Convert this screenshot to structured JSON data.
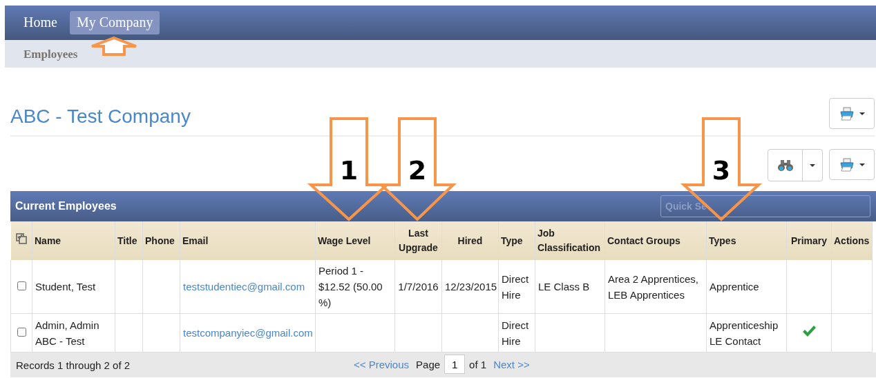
{
  "nav": {
    "items": [
      {
        "label": "Home",
        "selected": false
      },
      {
        "label": "My Company",
        "selected": true
      }
    ]
  },
  "subnav": {
    "items": [
      {
        "label": "Employees"
      }
    ]
  },
  "page_title": "ABC - Test Company",
  "panel": {
    "title": "Current Employees",
    "search": {
      "placeholder": "Quick Se"
    },
    "columns": [
      "Name",
      "Title",
      "Phone",
      "Email",
      "Wage Level",
      "Last Upgrade",
      "Hired",
      "Type",
      "Job Classification",
      "Contact Groups",
      "Types",
      "Primary",
      "Actions"
    ],
    "rows": [
      {
        "selected": false,
        "name": "Student, Test",
        "title": "",
        "phone": "",
        "email": "teststudentiec@gmail.com",
        "wage_level": "Period 1 - $12.52 (50.00 %)",
        "last_upgrade": "1/7/2016",
        "hired": "12/23/2015",
        "type": "Direct Hire",
        "job_classification": "LE Class B",
        "contact_groups": "Area 2 Apprentices, LEB Apprentices",
        "types": [
          "Apprentice"
        ],
        "primary": false
      },
      {
        "selected": false,
        "name": "Admin, Admin ABC - Test",
        "title": "",
        "phone": "",
        "email": "testcompanyiec@gmail.com",
        "wage_level": "",
        "last_upgrade": "",
        "hired": "",
        "type": "Direct Hire",
        "job_classification": "",
        "contact_groups": "",
        "types": [
          "Apprenticeship",
          "LE Contact"
        ],
        "primary": true
      }
    ],
    "footer": {
      "records": "Records 1 through 2 of 2",
      "previous": "<< Previous",
      "page_label": "Page",
      "page": "1",
      "of": "of 1",
      "next": "Next >>"
    }
  },
  "annotations": [
    {
      "kind": "up"
    },
    {
      "kind": "down",
      "label": "1"
    },
    {
      "kind": "down",
      "label": "2"
    },
    {
      "kind": "down",
      "label": "3"
    }
  ]
}
